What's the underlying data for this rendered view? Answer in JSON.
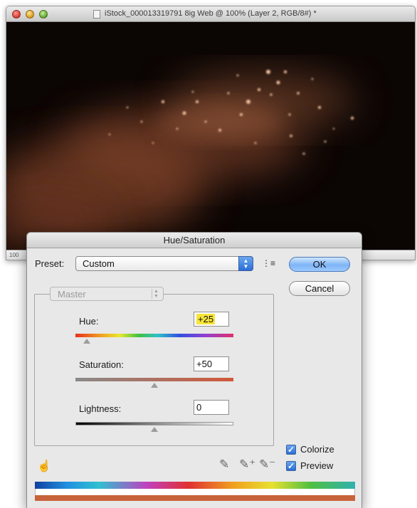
{
  "document_window": {
    "title": "iStock_000013319791 8ig Web @ 100% (Layer 2, RGB/8#) *",
    "zoom_readout": "100"
  },
  "dialog": {
    "title": "Hue/Saturation",
    "preset_label": "Preset:",
    "preset_value": "Custom",
    "preset_options_icon": "preset-options-icon",
    "ok_label": "OK",
    "cancel_label": "Cancel",
    "channel_value": "Master",
    "hue": {
      "label": "Hue:",
      "value": "+25",
      "slider_level": 0.07
    },
    "saturation": {
      "label": "Saturation:",
      "value": "+50",
      "slider_level": 0.5
    },
    "lightness": {
      "label": "Lightness:",
      "value": "0",
      "slider_level": 0.5
    },
    "colorize": {
      "label": "Colorize",
      "checked": true
    },
    "preview": {
      "label": "Preview",
      "checked": true
    },
    "icons": [
      "hand-icon",
      "eyedropper-icon",
      "eyedropper-plus-icon",
      "eyedropper-minus-icon"
    ],
    "colors": {
      "result_bar": "#c8623a",
      "accent": "#2a6ed8",
      "highlight": "#f7e43a"
    }
  }
}
